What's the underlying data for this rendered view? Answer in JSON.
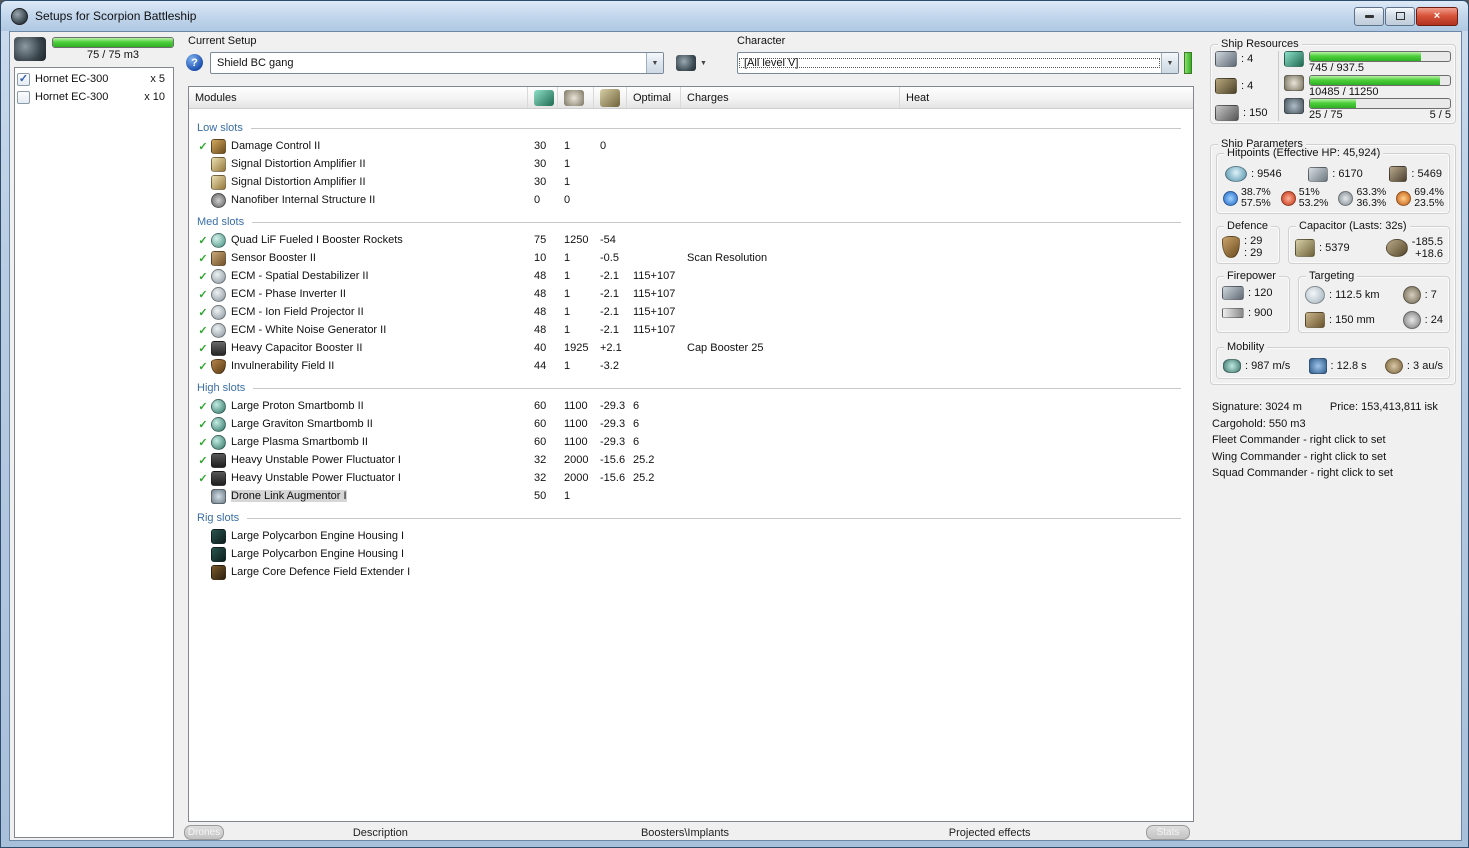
{
  "glyphs": {
    "check": "✓",
    "dropdown": "▼",
    "help": "?",
    "close": "×"
  },
  "window": {
    "title": "Setups for Scorpion Battleship"
  },
  "drone_bay": {
    "capacity_label": "75 / 75 m3",
    "capacity_pct": 100,
    "items": [
      {
        "name": "Hornet EC-300",
        "qty": "x 5",
        "checked": true
      },
      {
        "name": "Hornet EC-300",
        "qty": "x 10",
        "checked": false
      }
    ]
  },
  "setup": {
    "label": "Current Setup",
    "value": "Shield BC gang"
  },
  "character": {
    "label": "Character",
    "value": "[All level V]"
  },
  "modules_table": {
    "header": {
      "modules": "Modules",
      "optimal": "Optimal",
      "charges": "Charges",
      "heat": "Heat"
    },
    "sections": [
      {
        "title": "Low slots",
        "rows": [
          {
            "ok": true,
            "icon": "damage-control",
            "name": "Damage Control II",
            "cpu": "30",
            "pg": "1",
            "cap": "0",
            "optimal": "",
            "charges": ""
          },
          {
            "ok": false,
            "icon": "signal-amp",
            "name": "Signal Distortion Amplifier II",
            "cpu": "30",
            "pg": "1",
            "cap": "",
            "optimal": "",
            "charges": ""
          },
          {
            "ok": false,
            "icon": "signal-amp",
            "name": "Signal Distortion Amplifier II",
            "cpu": "30",
            "pg": "1",
            "cap": "",
            "optimal": "",
            "charges": ""
          },
          {
            "ok": false,
            "icon": "nanofiber",
            "name": "Nanofiber Internal Structure II",
            "cpu": "0",
            "pg": "0",
            "cap": "",
            "optimal": "",
            "charges": ""
          }
        ]
      },
      {
        "title": "Med slots",
        "rows": [
          {
            "ok": true,
            "icon": "rocket-charge",
            "name": "Quad LiF Fueled I Booster Rockets",
            "cpu": "75",
            "pg": "1250",
            "cap": "-54",
            "optimal": "",
            "charges": ""
          },
          {
            "ok": true,
            "icon": "sensor-booster",
            "name": "Sensor Booster II",
            "cpu": "10",
            "pg": "1",
            "cap": "-0.5",
            "optimal": "",
            "charges": "Scan Resolution"
          },
          {
            "ok": true,
            "icon": "ecm",
            "name": "ECM - Spatial Destabilizer II",
            "cpu": "48",
            "pg": "1",
            "cap": "-2.1",
            "optimal": "115+107",
            "charges": ""
          },
          {
            "ok": true,
            "icon": "ecm",
            "name": "ECM - Phase Inverter II",
            "cpu": "48",
            "pg": "1",
            "cap": "-2.1",
            "optimal": "115+107",
            "charges": ""
          },
          {
            "ok": true,
            "icon": "ecm",
            "name": "ECM - Ion Field Projector II",
            "cpu": "48",
            "pg": "1",
            "cap": "-2.1",
            "optimal": "115+107",
            "charges": ""
          },
          {
            "ok": true,
            "icon": "ecm",
            "name": "ECM - White Noise Generator II",
            "cpu": "48",
            "pg": "1",
            "cap": "-2.1",
            "optimal": "115+107",
            "charges": ""
          },
          {
            "ok": true,
            "icon": "cap-booster",
            "name": "Heavy Capacitor Booster II",
            "cpu": "40",
            "pg": "1925",
            "cap": "+2.1",
            "optimal": "",
            "charges": "Cap Booster 25"
          },
          {
            "ok": true,
            "icon": "invuln",
            "name": "Invulnerability Field II",
            "cpu": "44",
            "pg": "1",
            "cap": "-3.2",
            "optimal": "",
            "charges": ""
          }
        ]
      },
      {
        "title": "High slots",
        "rows": [
          {
            "ok": true,
            "icon": "smartbomb",
            "name": "Large Proton Smartbomb II",
            "cpu": "60",
            "pg": "1100",
            "cap": "-29.3",
            "optimal": "6",
            "charges": ""
          },
          {
            "ok": true,
            "icon": "smartbomb",
            "name": "Large Graviton Smartbomb II",
            "cpu": "60",
            "pg": "1100",
            "cap": "-29.3",
            "optimal": "6",
            "charges": ""
          },
          {
            "ok": true,
            "icon": "smartbomb",
            "name": "Large Plasma Smartbomb II",
            "cpu": "60",
            "pg": "1100",
            "cap": "-29.3",
            "optimal": "6",
            "charges": ""
          },
          {
            "ok": true,
            "icon": "fluctuator",
            "name": "Heavy Unstable Power Fluctuator I",
            "cpu": "32",
            "pg": "2000",
            "cap": "-15.6",
            "optimal": "25.2",
            "charges": ""
          },
          {
            "ok": true,
            "icon": "fluctuator",
            "name": "Heavy Unstable Power Fluctuator I",
            "cpu": "32",
            "pg": "2000",
            "cap": "-15.6",
            "optimal": "25.2",
            "charges": ""
          },
          {
            "ok": false,
            "icon": "drone-link",
            "name": "Drone Link Augmentor I",
            "cpu": "50",
            "pg": "1",
            "cap": "",
            "optimal": "",
            "charges": "",
            "selected": true
          }
        ]
      },
      {
        "title": "Rig slots",
        "rows": [
          {
            "ok": false,
            "icon": "rig-polycarbon",
            "name": "Large Polycarbon Engine Housing I",
            "cpu": "",
            "pg": "",
            "cap": "",
            "optimal": "",
            "charges": ""
          },
          {
            "ok": false,
            "icon": "rig-polycarbon",
            "name": "Large Polycarbon Engine Housing I",
            "cpu": "",
            "pg": "",
            "cap": "",
            "optimal": "",
            "charges": ""
          },
          {
            "ok": false,
            "icon": "rig-core",
            "name": "Large Core Defence Field Extender I",
            "cpu": "",
            "pg": "",
            "cap": "",
            "optimal": "",
            "charges": ""
          }
        ]
      }
    ]
  },
  "bottom_bar": {
    "drones": "Drones",
    "description": "Description",
    "boosters": "Boosters\\Implants",
    "projected": "Projected effects",
    "stats": "Stats"
  },
  "ship_resources": {
    "legend": "Ship Resources",
    "turrets": ": 4",
    "launchers": ": 4",
    "calibration": ": 150",
    "cpu": {
      "text": "745 / 937.5",
      "pct": 79
    },
    "powergrid": {
      "text": "10485 / 11250",
      "pct": 93
    },
    "drone": {
      "text": "25 / 75",
      "extra": "5 / 5",
      "pct": 33
    }
  },
  "ship_parameters": {
    "legend": "Ship Parameters",
    "hitpoints": {
      "legend": "Hitpoints (Effective HP: 45,924)",
      "shield": ": 9546",
      "armor": ": 6170",
      "structure": ": 5469",
      "resists": [
        {
          "icon": "em-resist-icon",
          "top": "38.7%",
          "bottom": "57.5%"
        },
        {
          "icon": "thermal-resist-icon",
          "top": "51%",
          "bottom": "53.2%"
        },
        {
          "icon": "kinetic-resist-icon",
          "top": "63.3%",
          "bottom": "36.3%"
        },
        {
          "icon": "explosive-resist-icon",
          "top": "69.4%",
          "bottom": "23.5%"
        }
      ]
    },
    "defence": {
      "legend": "Defence",
      "top": ": 29",
      "bottom": ": 29"
    },
    "capacitor": {
      "legend": "Capacitor (Lasts: 32s)",
      "amount": ": 5379",
      "out": "-185.5",
      "in": "+18.6"
    },
    "firepower": {
      "legend": "Firepower",
      "turret": ": 120",
      "missile": ": 900"
    },
    "targeting": {
      "legend": "Targeting",
      "range": ": 112.5 km",
      "sensor": ": 150 mm",
      "max_targets": ": 7",
      "scan_res": ": 24"
    },
    "mobility": {
      "legend": "Mobility",
      "speed": ": 987 m/s",
      "agility": ": 12.8 s",
      "warp": ": 3 au/s"
    }
  },
  "summary": {
    "signature": "Signature: 3024 m",
    "price": "Price: 153,413,811 isk",
    "cargohold": "Cargohold: 550 m3",
    "fleet": "Fleet Commander - right click to set",
    "wing": "Wing Commander - right click to set",
    "squad": "Squad Commander - right click to set"
  }
}
